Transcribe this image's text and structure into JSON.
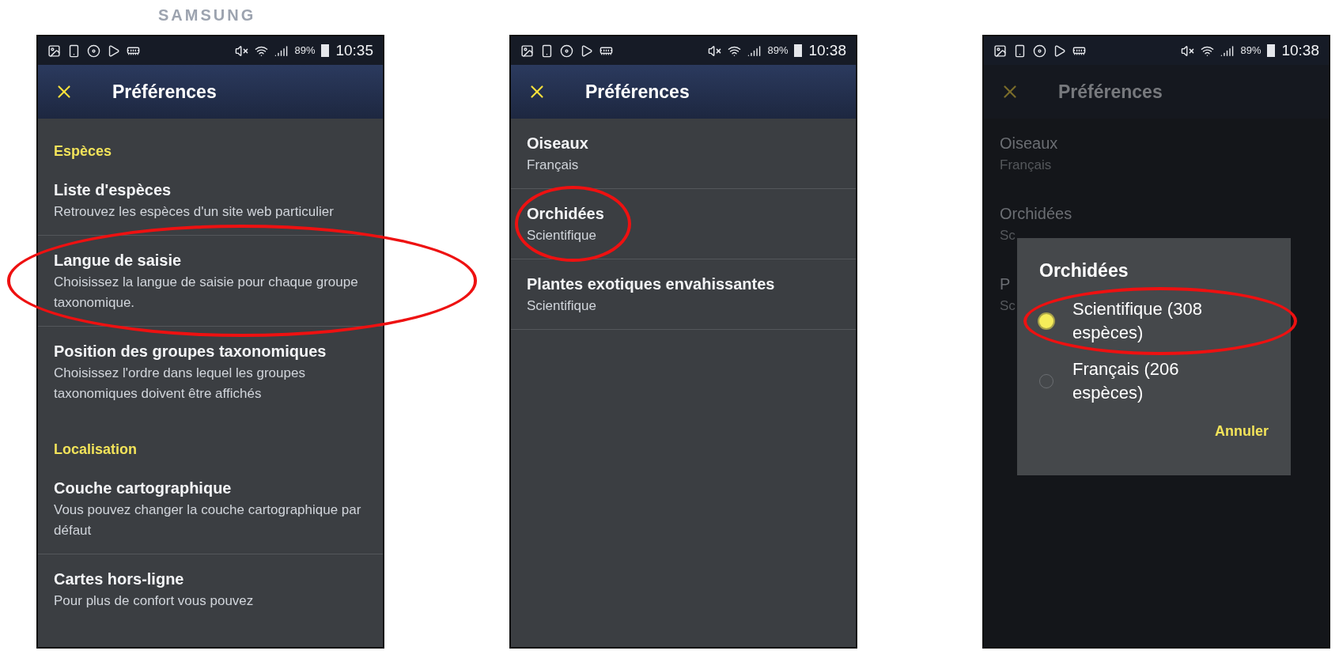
{
  "brand": "SAMSUNG",
  "screens": [
    {
      "dimmed": false,
      "status_bar": {
        "battery": "89%",
        "time": "10:35"
      },
      "title": "Préférences",
      "sections": [
        {
          "header": "Espèces",
          "items": [
            {
              "title": "Liste d'espèces",
              "subtitle": "Retrouvez les espèces d'un site web particulier",
              "circled": false
            },
            {
              "title": "Langue de saisie",
              "subtitle": "Choisissez la langue de saisie pour chaque groupe taxonomique.",
              "circled": true
            },
            {
              "title": "Position des groupes taxonomiques",
              "subtitle": "Choisissez l'ordre dans lequel les groupes taxonomiques doivent être affichés",
              "circled": false
            }
          ]
        },
        {
          "header": "Localisation",
          "items": [
            {
              "title": "Couche cartographique",
              "subtitle": "Vous pouvez changer la couche cartographique par défaut",
              "circled": false
            },
            {
              "title": "Cartes hors-ligne",
              "subtitle": "Pour plus de confort vous pouvez",
              "circled": false
            }
          ]
        }
      ]
    },
    {
      "dimmed": false,
      "status_bar": {
        "battery": "89%",
        "time": "10:38"
      },
      "title": "Préférences",
      "sections": [
        {
          "items": [
            {
              "title": "Oiseaux",
              "subtitle": "Français",
              "circled": false
            },
            {
              "title": "Orchidées",
              "subtitle": "Scientifique",
              "circled": true
            },
            {
              "title": "Plantes exotiques envahissantes",
              "subtitle": "Scientifique",
              "circled": false
            }
          ]
        }
      ]
    },
    {
      "dimmed": true,
      "status_bar": {
        "battery": "89%",
        "time": "10:38"
      },
      "title": "Préférences",
      "sections": [
        {
          "items": [
            {
              "title": "Oiseaux",
              "subtitle": "Français",
              "circled": false
            },
            {
              "title": "Orchidées",
              "subtitle": "Sc",
              "circled": false
            },
            {
              "title": "P",
              "subtitle": "Sc",
              "circled": false
            }
          ]
        }
      ],
      "dialog": {
        "title": "Orchidées",
        "options": [
          {
            "label": "Scientifique (308 espèces)",
            "selected": true,
            "circled": true
          },
          {
            "label": "Français (206 espèces)",
            "selected": false,
            "circled": false
          }
        ],
        "cancel": "Annuler"
      }
    }
  ]
}
